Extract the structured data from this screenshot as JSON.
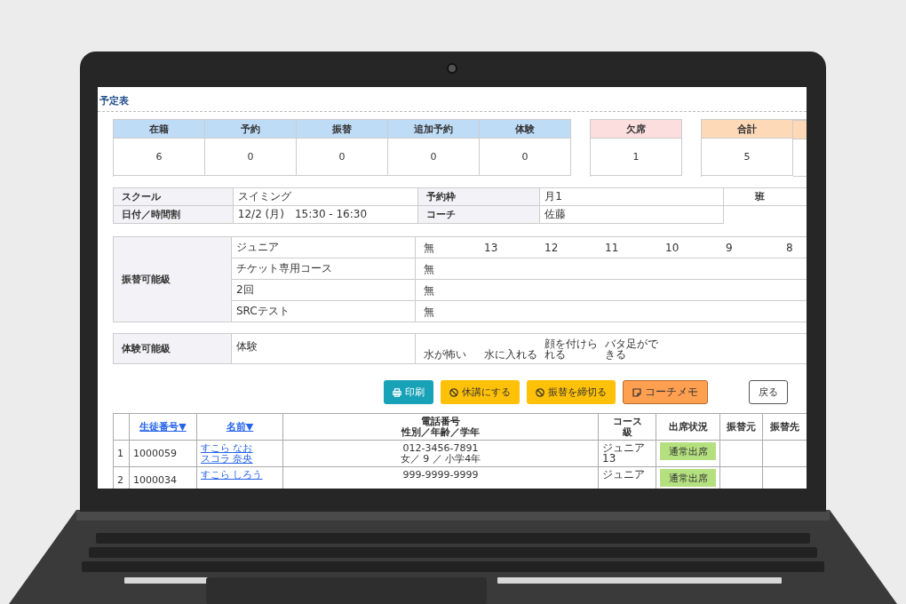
{
  "page_title": "予定表",
  "summary": [
    {
      "label": "在籍",
      "value": "6",
      "color": "#bfdcf7"
    },
    {
      "label": "予約",
      "value": "0",
      "color": "#bfdcf7"
    },
    {
      "label": "振替",
      "value": "0",
      "color": "#bfdcf7"
    },
    {
      "label": "追加予約",
      "value": "0",
      "color": "#bfdcf7"
    },
    {
      "label": "体験",
      "value": "0",
      "color": "#bfdcf7"
    },
    {
      "label": "欠席",
      "value": "1",
      "color": "#fddede"
    },
    {
      "label": "合計",
      "value": "5",
      "color": "#fdd9b8"
    }
  ],
  "info": [
    [
      {
        "label": "スクール",
        "value": "スイミング"
      },
      {
        "label": "予約枠",
        "value": "月1"
      },
      {
        "label": "班"
      }
    ],
    [
      {
        "label": "日付／時間割",
        "value": "12/2 (月)　15:30 - 16:30"
      },
      {
        "label": "コーチ",
        "value": "佐藤"
      }
    ]
  ],
  "transfer_levels": {
    "label": "振替可能級",
    "rows": [
      {
        "course": "ジュニア",
        "levels": [
          "無",
          "13",
          "12",
          "11",
          "10",
          "9",
          "8"
        ]
      },
      {
        "course": "チケット専用コース",
        "levels": [
          "無"
        ]
      },
      {
        "course": "2回",
        "levels": [
          "無"
        ]
      },
      {
        "course": "SRCテスト",
        "levels": [
          "無"
        ]
      }
    ]
  },
  "trial_levels": {
    "label": "体験可能級",
    "rows": [
      {
        "course": "体験",
        "levels": [
          "水が怖い",
          "水に入れる",
          "顔を付けられる",
          "バタ足ができる"
        ]
      }
    ]
  },
  "buttons": [
    {
      "label": "印刷",
      "kind": "print"
    },
    {
      "label": "休講にする",
      "kind": "cancel"
    },
    {
      "label": "振替を締切る",
      "kind": "close"
    },
    {
      "label": "コーチメモ",
      "kind": "memo"
    },
    {
      "label": "戻る",
      "kind": "back"
    }
  ],
  "columns": [
    {
      "lines": [
        "生徒番号▼"
      ],
      "link": true
    },
    {
      "lines": [
        "名前▼"
      ],
      "link": true
    },
    {
      "lines": [
        "電話番号",
        "性別／年齢／学年"
      ],
      "link": false
    },
    {
      "lines": [
        "コース",
        "級"
      ],
      "link": false
    },
    {
      "lines": [
        "出席状況"
      ],
      "link": false
    },
    {
      "lines": [
        "振替元"
      ],
      "link": false
    },
    {
      "lines": [
        "振替先"
      ],
      "link": false
    }
  ],
  "students": [
    {
      "no": "1",
      "id": "1000059",
      "name": [
        "すこら なお",
        "スコラ 奈央"
      ],
      "phone": [
        "012-3456-7891",
        "女／ 9 ／ 小学4年"
      ],
      "course": [
        "ジュニア",
        "13"
      ],
      "attendance": "通常出席"
    },
    {
      "no": "2",
      "id": "1000034",
      "name": [
        "すこら しろう"
      ],
      "phone": [
        "999-9999-9999"
      ],
      "course": [
        "ジュニア"
      ],
      "attendance": "通常出席"
    }
  ]
}
